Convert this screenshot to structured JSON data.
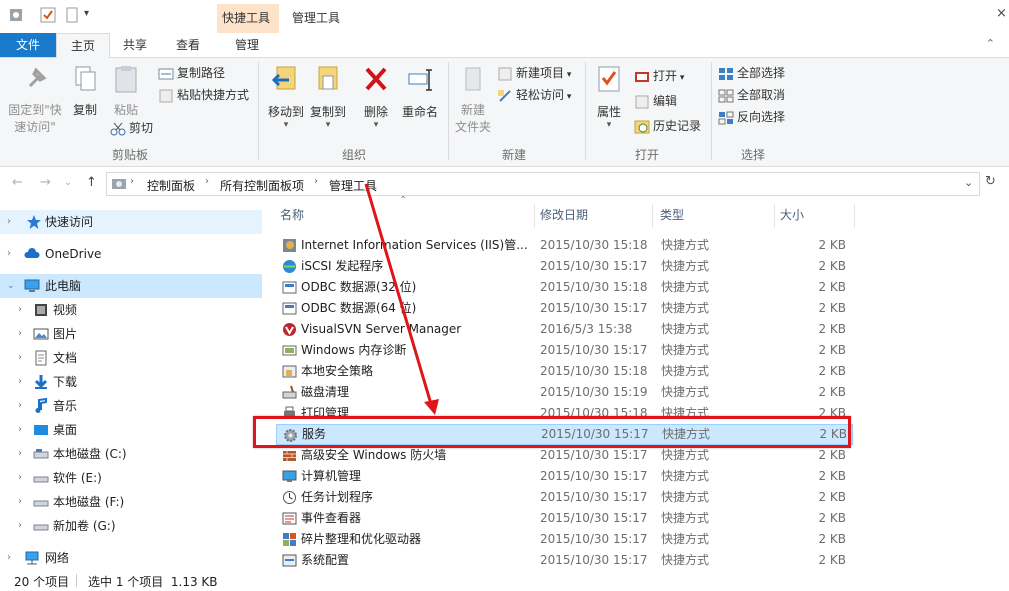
{
  "titlebar": {
    "context_tab": "快捷工具",
    "title": "管理工具"
  },
  "tabs": [
    {
      "label": "文件"
    },
    {
      "label": "主页"
    },
    {
      "label": "共享"
    },
    {
      "label": "查看"
    },
    {
      "label": "管理"
    }
  ],
  "ribbon": {
    "clipboard": {
      "group_label": "剪贴板",
      "pin_label_1": "固定到\"快",
      "pin_label_2": "速访问\"",
      "copy": "复制",
      "paste": "粘贴",
      "copy_path": "复制路径",
      "paste_shortcut": "粘贴快捷方式",
      "cut": "剪切"
    },
    "organize": {
      "group_label": "组织",
      "move_to": "移动到",
      "copy_to": "复制到",
      "delete": "删除",
      "rename": "重命名"
    },
    "new": {
      "group_label": "新建",
      "new_folder_1": "新建",
      "new_folder_2": "文件夹",
      "new_item": "新建项目",
      "easy_access": "轻松访问"
    },
    "open": {
      "group_label": "打开",
      "properties": "属性",
      "open": "打开",
      "edit": "编辑",
      "history": "历史记录"
    },
    "select": {
      "group_label": "选择",
      "select_all": "全部选择",
      "select_none": "全部取消",
      "invert": "反向选择"
    }
  },
  "address": {
    "crumbs": [
      "控制面板",
      "所有控制面板项",
      "管理工具"
    ]
  },
  "sidebar": {
    "items": [
      {
        "label": "快速访问",
        "icon": "star-icon"
      },
      {
        "label": "OneDrive",
        "icon": "cloud-icon"
      },
      {
        "label": "此电脑",
        "icon": "computer-icon"
      },
      {
        "label": "视频",
        "icon": "video-icon"
      },
      {
        "label": "图片",
        "icon": "pictures-icon"
      },
      {
        "label": "文档",
        "icon": "documents-icon"
      },
      {
        "label": "下载",
        "icon": "download-icon"
      },
      {
        "label": "音乐",
        "icon": "music-icon"
      },
      {
        "label": "桌面",
        "icon": "desktop-icon"
      },
      {
        "label": "本地磁盘 (C:)",
        "icon": "drive-icon"
      },
      {
        "label": "软件 (E:)",
        "icon": "drive-icon"
      },
      {
        "label": "本地磁盘 (F:)",
        "icon": "drive-icon"
      },
      {
        "label": "新加卷 (G:)",
        "icon": "drive-icon"
      },
      {
        "label": "网络",
        "icon": "network-icon"
      }
    ]
  },
  "columns": {
    "name": "名称",
    "date": "修改日期",
    "type": "类型",
    "size": "大小"
  },
  "files": [
    {
      "name": "Internet Information Services (IIS)管...",
      "date": "2015/10/30 15:18",
      "type": "快捷方式",
      "size": "2 KB"
    },
    {
      "name": "iSCSI 发起程序",
      "date": "2015/10/30 15:17",
      "type": "快捷方式",
      "size": "2 KB"
    },
    {
      "name": "ODBC 数据源(32 位)",
      "date": "2015/10/30 15:18",
      "type": "快捷方式",
      "size": "2 KB"
    },
    {
      "name": "ODBC 数据源(64 位)",
      "date": "2015/10/30 15:17",
      "type": "快捷方式",
      "size": "2 KB"
    },
    {
      "name": "VisualSVN Server Manager",
      "date": "2016/5/3 15:38",
      "type": "快捷方式",
      "size": "2 KB"
    },
    {
      "name": "Windows 内存诊断",
      "date": "2015/10/30 15:17",
      "type": "快捷方式",
      "size": "2 KB"
    },
    {
      "name": "本地安全策略",
      "date": "2015/10/30 15:18",
      "type": "快捷方式",
      "size": "2 KB"
    },
    {
      "name": "磁盘清理",
      "date": "2015/10/30 15:19",
      "type": "快捷方式",
      "size": "2 KB"
    },
    {
      "name": "打印管理",
      "date": "2015/10/30 15:18",
      "type": "快捷方式",
      "size": "2 KB"
    },
    {
      "name": "服务",
      "date": "2015/10/30 15:17",
      "type": "快捷方式",
      "size": "2 KB"
    },
    {
      "name": "高级安全 Windows 防火墙",
      "date": "2015/10/30 15:17",
      "type": "快捷方式",
      "size": "2 KB"
    },
    {
      "name": "计算机管理",
      "date": "2015/10/30 15:17",
      "type": "快捷方式",
      "size": "2 KB"
    },
    {
      "name": "任务计划程序",
      "date": "2015/10/30 15:17",
      "type": "快捷方式",
      "size": "2 KB"
    },
    {
      "name": "事件查看器",
      "date": "2015/10/30 15:17",
      "type": "快捷方式",
      "size": "2 KB"
    },
    {
      "name": "碎片整理和优化驱动器",
      "date": "2015/10/30 15:17",
      "type": "快捷方式",
      "size": "2 KB"
    },
    {
      "name": "系统配置",
      "date": "2015/10/30 15:17",
      "type": "快捷方式",
      "size": "2 KB"
    }
  ],
  "selected_file": "服务",
  "status": {
    "count": "20 个项目",
    "selection": "选中 1 个项目  1.13 KB"
  },
  "colors": {
    "accent": "#1979ca",
    "selection": "#cce8ff",
    "annotation": "#e0151b",
    "context_tab": "#fde3c9"
  }
}
